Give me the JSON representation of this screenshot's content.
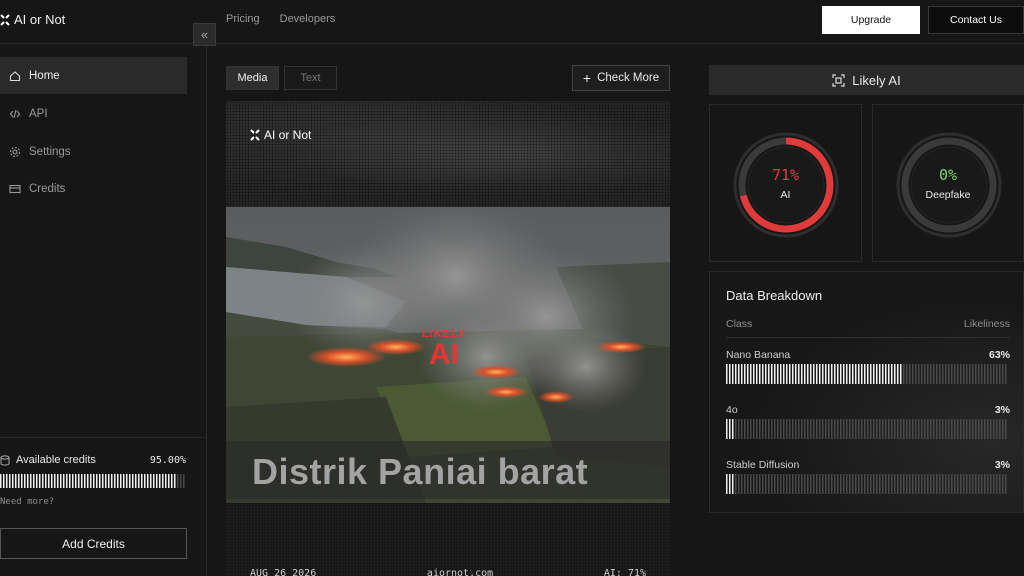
{
  "header": {
    "brand": "AI or Not",
    "nav": [
      "Pricing",
      "Developers"
    ],
    "upgrade_label": "Upgrade",
    "contact_label": "Contact Us"
  },
  "sidebar": {
    "items": [
      {
        "label": "Home",
        "icon": "home-icon",
        "active": true
      },
      {
        "label": "API",
        "icon": "code-icon",
        "active": false
      },
      {
        "label": "Settings",
        "icon": "gear-icon",
        "active": false
      },
      {
        "label": "Credits",
        "icon": "card-icon",
        "active": false
      }
    ],
    "collapse_icon": "double-chevron-left-icon",
    "credits_label": "Available credits",
    "credits_value": "95.00%",
    "credits_fraction": 0.95,
    "need_more": "Need more?",
    "add_credits_label": "Add Credits"
  },
  "main": {
    "tabs": [
      {
        "label": "Media",
        "active": true
      },
      {
        "label": "Text",
        "active": false
      }
    ],
    "check_more_label": "Check More",
    "media": {
      "overlay_brand": "AI or Not",
      "stamp_line1": "LIKELY",
      "stamp_line2": "AI",
      "caption": "Distrik Paniai barat",
      "footer_date": "AUG 26 2026",
      "footer_site": "aiornot.com",
      "footer_score": "AI: 71%"
    }
  },
  "result": {
    "verdict": "Likely AI",
    "gauges": [
      {
        "value": "71%",
        "label": "AI",
        "fraction": 0.71,
        "color": "#e03a3a"
      },
      {
        "value": "0%",
        "label": "Deepfake",
        "fraction": 0.0,
        "color": "#7fd36b"
      }
    ],
    "breakdown": {
      "title": "Data Breakdown",
      "col_class": "Class",
      "col_likeliness": "Likeliness",
      "rows": [
        {
          "name": "Nano Banana",
          "value": "63%",
          "fraction": 0.63
        },
        {
          "name": "4o",
          "value": "3%",
          "fraction": 0.03
        },
        {
          "name": "Stable Diffusion",
          "value": "3%",
          "fraction": 0.03
        }
      ]
    }
  }
}
